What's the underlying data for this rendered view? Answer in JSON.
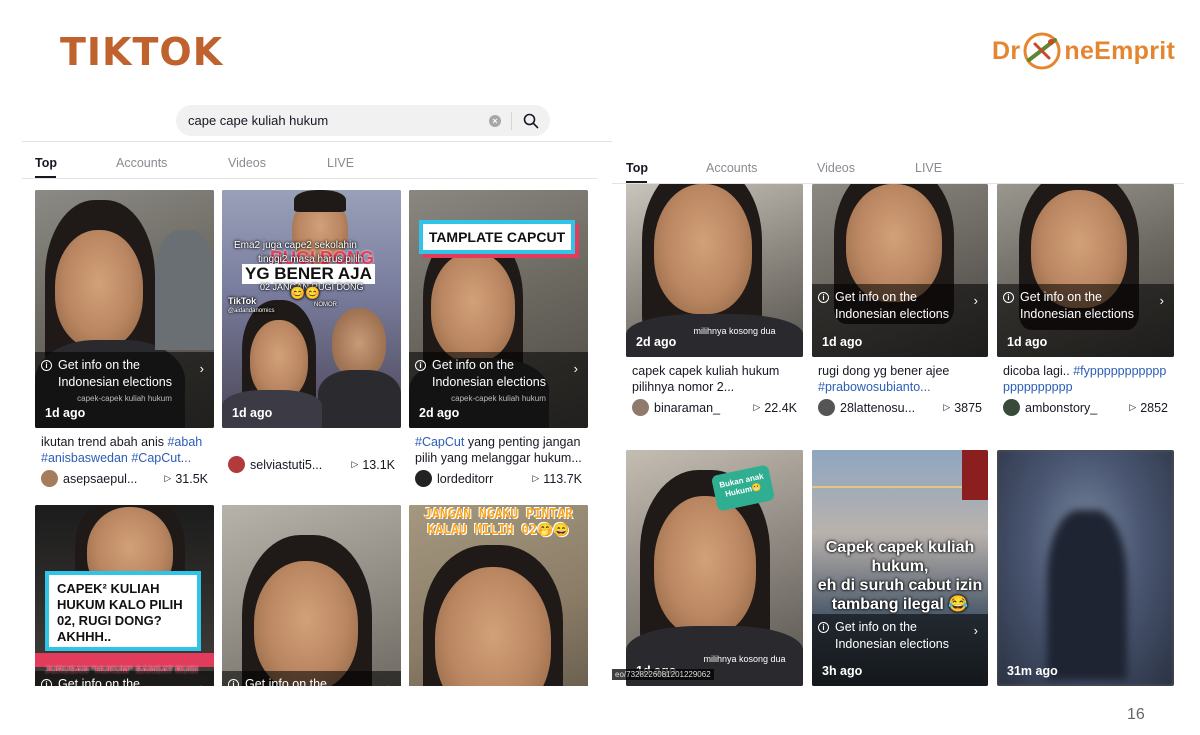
{
  "slide": {
    "title": "TIKTOK",
    "logo_text_a": "Dr",
    "logo_text_b": "neEmprit",
    "page_number": "16"
  },
  "left": {
    "search": {
      "query": "cape cape kuliah hukum"
    },
    "tabs": [
      "Top",
      "Accounts",
      "Videos",
      "LIVE"
    ],
    "cards": [
      {
        "ago": "1d ago",
        "info_a": "Get info on the",
        "info_b": "Indonesian elections",
        "sub": "capek-capek kuliah hukum",
        "desc_pre": "ikutan trend abah anis ",
        "desc_tags": "#abah #anisbaswedan #CapCut...",
        "user": "asepsaepul...",
        "views": "31.5K"
      },
      {
        "ago": "1d ago",
        "overlay_a": "Ema2 juga cape2 sekolahin",
        "overlay_b": "RUGI DONG",
        "overlay_c": "tinggi2 masa harus pilih",
        "overlay_d": "YG BENER AJA",
        "overlay_e": "02 JANGAN RUGI DONG",
        "brand": "TikTok",
        "handle": "@aidandanomics",
        "nomor": "NOMOR",
        "desc_pre": "",
        "desc_tags": "",
        "user": "selviastuti5...",
        "views": "13.1K"
      },
      {
        "ago": "2d ago",
        "info_a": "Get info on the",
        "info_b": "Indonesian elections",
        "sub": "capek-capek kuliah hukum",
        "banner": "TAMPLATE CAPCUT",
        "desc_tag0": "#CapCut",
        "desc_pre": " yang penting jangan pilih yang melanggar hukum...",
        "user": "lordeditorr",
        "views": "113.7K"
      },
      {
        "info_a": "Get info on the",
        "banner": "CAPEK² KULIAH HUKUM KALO PILIH 02, RUGI DONG? AKHHH..",
        "strip": "JURUSAN \"HUKUM\" SANGAT RUGI"
      },
      {
        "info_a": "Get info on the"
      },
      {
        "headline": "JANGAN NGAKU PINTAR KALAU MILIH 02🤭😄"
      }
    ]
  },
  "right": {
    "tabs": [
      "Top",
      "Accounts",
      "Videos",
      "LIVE"
    ],
    "cards": [
      {
        "ago": "2d ago",
        "sub": "milihnya kosong dua",
        "desc": "capek capek kuliah hukum pilihnya nomor 2...",
        "user": "binaraman_",
        "views": "22.4K"
      },
      {
        "ago": "1d ago",
        "info_a": "Get info on the",
        "info_b": "Indonesian elections",
        "desc_pre": "rugi dong yg bener ajee ",
        "desc_tags": "#prabowosubianto...",
        "user": "28lattenosu...",
        "views": "3875"
      },
      {
        "ago": "1d ago",
        "info_a": "Get info on the",
        "info_b": "Indonesian elections",
        "desc_pre": "dicoba lagi.. ",
        "desc_tags": "#fyppppppppppppppppppppp",
        "user": "ambonstory_",
        "views": "2852"
      },
      {
        "ago": "1d ago",
        "sub": "milihnya kosong dua",
        "sticker": "Bukan anak Hukum😬",
        "url": "eo/7328226081201229062"
      },
      {
        "ago": "3h ago",
        "info_a": "Get info on the",
        "info_b": "Indonesian elections",
        "overlay_a": "Capek capek kuliah",
        "overlay_b": "hukum,",
        "overlay_c": "eh di suruh cabut izin",
        "overlay_d": "tambang ilegal 😂"
      },
      {
        "ago": "31m ago"
      }
    ]
  },
  "colors": {
    "title": "#c0622e",
    "logo": "#e4862f",
    "hashtag": "#2b5db7",
    "logo_green": "#5a8a2f"
  }
}
